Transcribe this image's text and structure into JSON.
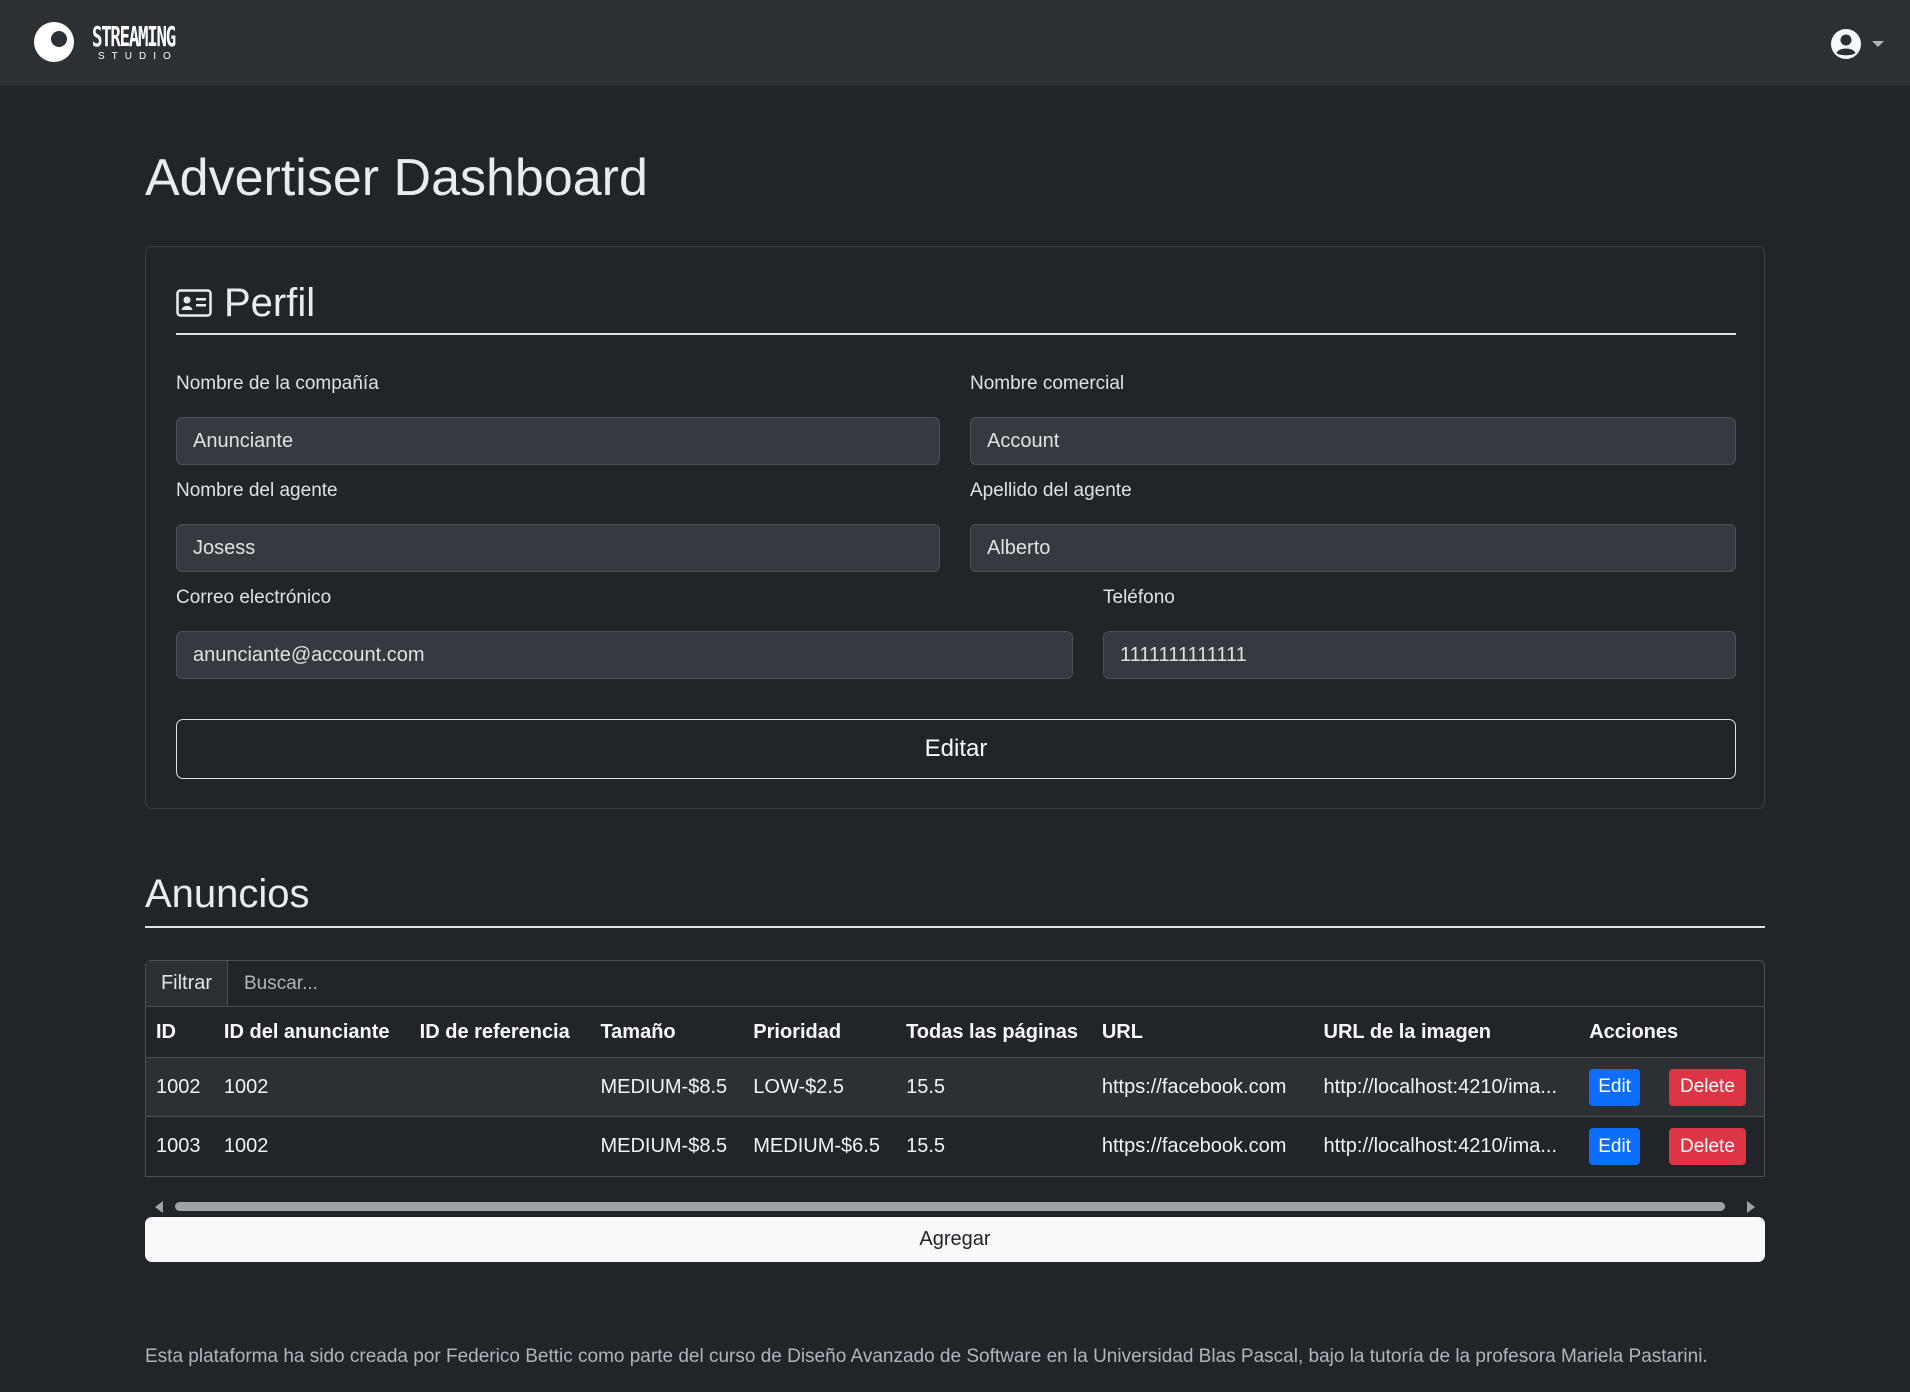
{
  "navbar": {
    "brand_main": "STREAMING",
    "brand_sub": "STUDIO"
  },
  "page_title": "Advertiser Dashboard",
  "profile": {
    "title": "Perfil",
    "fields": {
      "company_name": {
        "label": "Nombre de la compañía",
        "value": "Anunciante"
      },
      "commercial_name": {
        "label": "Nombre comercial",
        "value": "Account"
      },
      "agent_first_name": {
        "label": "Nombre del agente",
        "value": "Josess"
      },
      "agent_last_name": {
        "label": "Apellido del agente",
        "value": "Alberto"
      },
      "email": {
        "label": "Correo electrónico",
        "value": "anunciante@account.com"
      },
      "phone": {
        "label": "Teléfono",
        "value": "1111111111111"
      }
    },
    "edit_label": "Editar"
  },
  "ads": {
    "title": "Anuncios",
    "filter_label": "Filtrar",
    "search_placeholder": "Buscar...",
    "columns": [
      "ID",
      "ID del anunciante",
      "ID de referencia",
      "Tamaño",
      "Prioridad",
      "Todas las páginas",
      "URL",
      "URL de la imagen",
      "Acciones"
    ],
    "rows": [
      [
        "1002",
        "1002",
        "",
        "MEDIUM-$8.5",
        "LOW-$2.5",
        "15.5",
        "https://facebook.com",
        "http://localhost:4210/ima..."
      ],
      [
        "1003",
        "1002",
        "",
        "MEDIUM-$8.5",
        "MEDIUM-$6.5",
        "15.5",
        "https://facebook.com",
        "http://localhost:4210/ima..."
      ]
    ],
    "edit_action": "Edit",
    "delete_action": "Delete",
    "add_label": "Agregar"
  },
  "footer": "Esta plataforma ha sido creada por Federico Bettic como parte del curso de Diseño Avanzado de Software en la Universidad Blas Pascal, bajo la tutoría de la profesora Mariela Pastarini.",
  "colors": {
    "background": "#212529",
    "navbar": "#2b3035",
    "primary": "#0d6efd",
    "danger": "#dc3545"
  },
  "icons": [
    "logo-icon",
    "user-circle-icon",
    "id-card-icon"
  ]
}
